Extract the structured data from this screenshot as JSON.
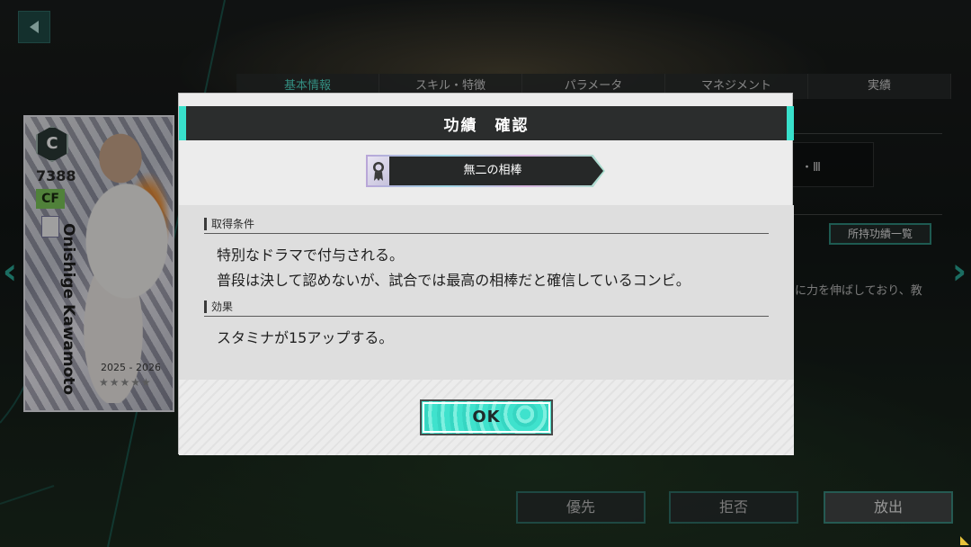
{
  "background": {
    "tabs": [
      "基本情報",
      "スキル・特徴",
      "パラメータ",
      "マネジメント",
      "実績"
    ],
    "active_tab_index": 0,
    "right_panel_text": "・Ⅲ",
    "medal_list_button": "所持功績一覧",
    "description_fragment": "に力を伸ばしており、教",
    "bottom_buttons": {
      "priority": "優先",
      "reject": "拒否",
      "release": "放出"
    }
  },
  "player_card": {
    "rank": "C",
    "rating": "7388",
    "position": "CF",
    "name": "Onishige Kawamoto",
    "season": "2025 - 2026",
    "stars": "★★★★★",
    "stars_filled": 0,
    "stars_total": 5
  },
  "dialog": {
    "title": "功績　確認",
    "medal_name": "無二の相棒",
    "acquisition_label": "取得条件",
    "acquisition_lines": [
      "特別なドラマで付与される。",
      "普段は決して認めないが、試合では最高の相棒だと確信しているコンビ。"
    ],
    "effect_label": "効果",
    "effect_lines": [
      "スタミナが15アップする。"
    ],
    "ok_label": "OK"
  },
  "colors": {
    "accent": "#38e0cb",
    "header_bg": "#2b2d2d",
    "dialog_bg": "#ececec"
  }
}
